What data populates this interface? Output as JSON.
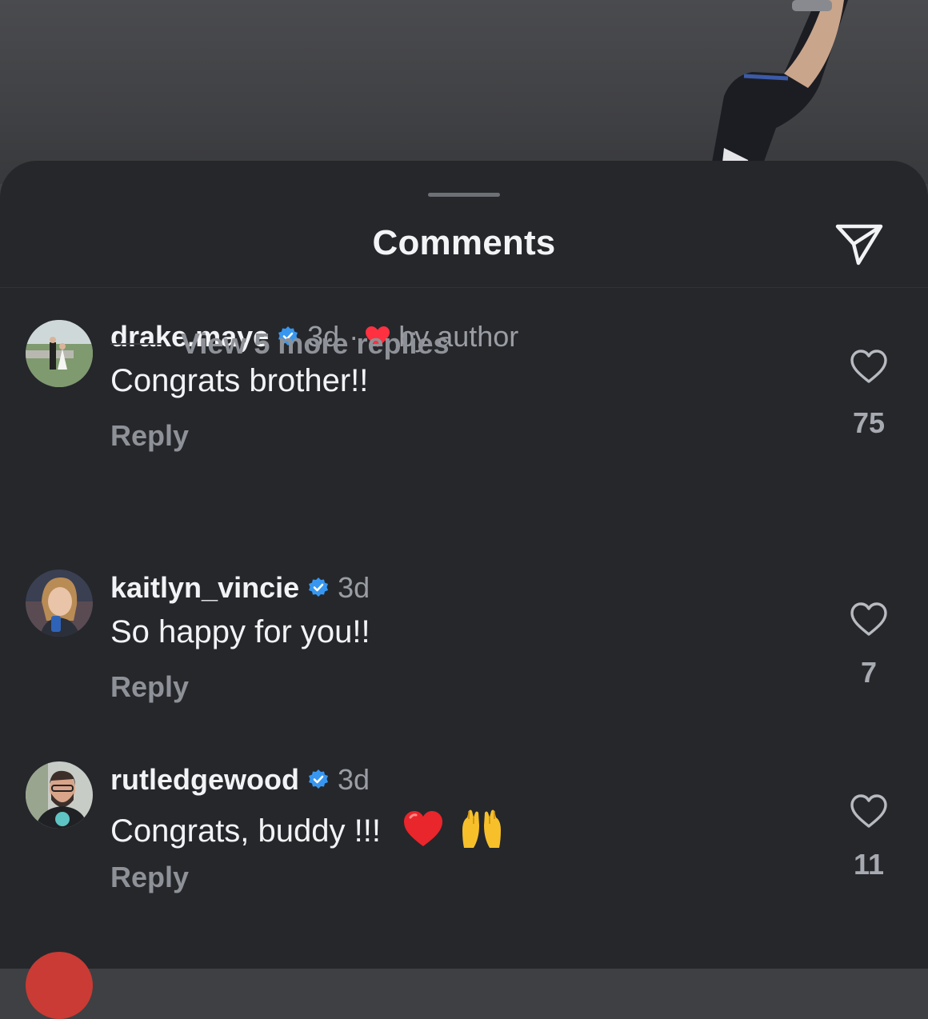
{
  "sheet": {
    "title": "Comments"
  },
  "comments": [
    {
      "username": "drake.maye",
      "verified": true,
      "time": "3d",
      "separator": "·",
      "author_like": "by author",
      "text": "Congrats brother!!",
      "reply_label": "Reply",
      "likes": "75",
      "view_replies": "View 5 more replies"
    },
    {
      "username": "kaitlyn_vincie",
      "verified": true,
      "time": "3d",
      "text": "So happy for you!!",
      "reply_label": "Reply",
      "likes": "7"
    },
    {
      "username": "rutledgewood",
      "verified": true,
      "time": "3d",
      "text": "Congrats, buddy !!!",
      "emojis": [
        "red-heart",
        "raising-hands"
      ],
      "reply_label": "Reply",
      "likes": "11"
    }
  ],
  "colors": {
    "sheet_background": "#25272b",
    "verified_badge": "#3797f0",
    "author_heart": "#ff3040",
    "text_primary": "#f2f3f5",
    "text_secondary": "#9a9da3"
  },
  "icons": {
    "share": "paper-plane-icon",
    "like": "heart-outline-icon",
    "verified": "verified-badge-icon"
  }
}
